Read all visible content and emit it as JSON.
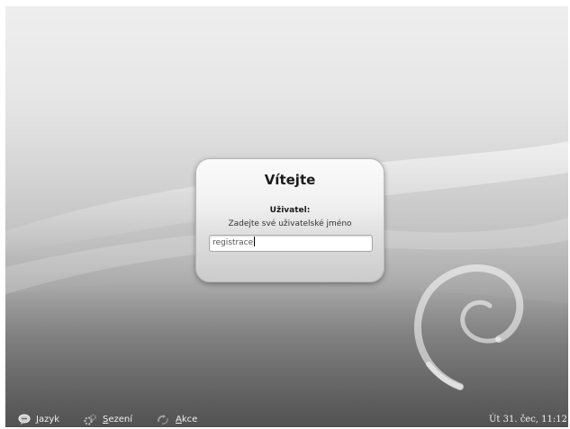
{
  "dialog": {
    "title": "Vítejte",
    "user_label": "Uživatel:",
    "prompt": "Zadejte své uživatelské jméno",
    "username_value": "registrace"
  },
  "bottom_bar": {
    "language": {
      "first": "J",
      "rest": "azyk",
      "icon": "language-bubble-icon"
    },
    "session": {
      "first": "S",
      "rest": "ezení",
      "icon": "session-gear-icon"
    },
    "actions": {
      "first": "A",
      "rest": "kce",
      "icon": "actions-arrows-icon"
    },
    "clock": "Út 31. čec, 11:12"
  },
  "colors": {
    "background_light": "#eeeeee",
    "background_dark": "#6d6d6d",
    "dialog": "#f0f0f0",
    "bar_text": "#f0f0f0"
  }
}
